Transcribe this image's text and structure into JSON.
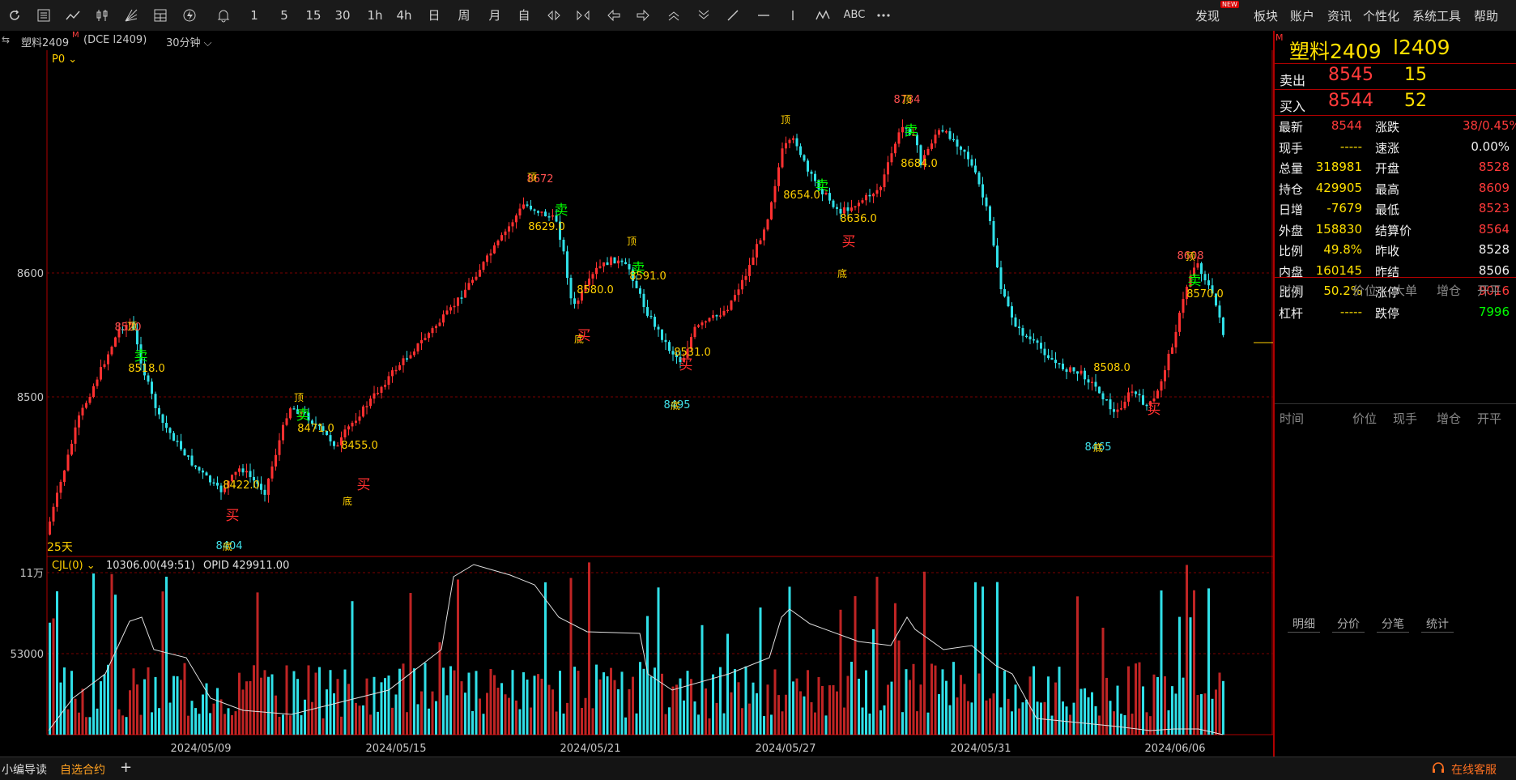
{
  "toolbar": {
    "icons": [
      "refresh-icon",
      "list-icon",
      "line-chart-icon",
      "candle-icon",
      "fan-icon",
      "grid-icon",
      "flash-icon",
      "bell-icon"
    ],
    "periods": [
      "1",
      "5",
      "15",
      "30",
      "1h",
      "4h",
      "日",
      "周",
      "月",
      "自"
    ],
    "right_menu": [
      "发现",
      "板块",
      "账户",
      "资讯",
      "个性化",
      "系统工具",
      "帮助"
    ],
    "new_badge": "NEW",
    "abc": "ABC"
  },
  "header": {
    "symbol": "塑料2409",
    "marker": "M",
    "exchange": "(DCE l2409)",
    "period": "30分钟"
  },
  "main_panel": {
    "indicator": "P0",
    "y_ticks": [
      "8600",
      "8500"
    ],
    "days_label": "25天"
  },
  "volume_panel": {
    "indicator": "CJL(0)",
    "value": "10306.00(49:51)",
    "opid": "OPID 429911.00",
    "y_ticks": [
      "11万",
      "53000"
    ]
  },
  "x_dates": [
    "2024/05/09",
    "2024/05/15",
    "2024/05/21",
    "2024/05/27",
    "2024/05/31",
    "2024/06/06"
  ],
  "annotations": [
    {
      "text": "8520",
      "kind": "hi"
    },
    {
      "text": "顶",
      "kind": "top"
    },
    {
      "text": "卖",
      "kind": "sell"
    },
    {
      "text": "8518.0",
      "kind": "price"
    },
    {
      "text": "顶",
      "kind": "top"
    },
    {
      "text": "卖",
      "kind": "sell"
    },
    {
      "text": "8471.0",
      "kind": "price"
    },
    {
      "text": "8422.0",
      "kind": "price"
    },
    {
      "text": "买",
      "kind": "buy"
    },
    {
      "text": "8404",
      "kind": "lo"
    },
    {
      "text": "底",
      "kind": "bottom"
    },
    {
      "text": "8455.0",
      "kind": "price"
    },
    {
      "text": "底",
      "kind": "bottom"
    },
    {
      "text": "买",
      "kind": "buy"
    },
    {
      "text": "8672",
      "kind": "hi"
    },
    {
      "text": "顶",
      "kind": "top"
    },
    {
      "text": "卖",
      "kind": "sell"
    },
    {
      "text": "8629.0",
      "kind": "price"
    },
    {
      "text": "8580.0",
      "kind": "price"
    },
    {
      "text": "底",
      "kind": "bottom"
    },
    {
      "text": "买",
      "kind": "buy"
    },
    {
      "text": "顶",
      "kind": "top"
    },
    {
      "text": "卖",
      "kind": "sell"
    },
    {
      "text": "8591.0",
      "kind": "price"
    },
    {
      "text": "8531.0",
      "kind": "price"
    },
    {
      "text": "买",
      "kind": "buy"
    },
    {
      "text": "8495",
      "kind": "lo"
    },
    {
      "text": "底",
      "kind": "bottom"
    },
    {
      "text": "顶",
      "kind": "top"
    },
    {
      "text": "卖",
      "kind": "sell"
    },
    {
      "text": "8654.0",
      "kind": "price"
    },
    {
      "text": "8636.0",
      "kind": "price"
    },
    {
      "text": "买",
      "kind": "buy"
    },
    {
      "text": "底",
      "kind": "bottom"
    },
    {
      "text": "8734",
      "kind": "hi"
    },
    {
      "text": "顶",
      "kind": "top"
    },
    {
      "text": "卖",
      "kind": "sell"
    },
    {
      "text": "8684.0",
      "kind": "price"
    },
    {
      "text": "8508.0",
      "kind": "price"
    },
    {
      "text": "8465",
      "kind": "lo"
    },
    {
      "text": "底",
      "kind": "bottom"
    },
    {
      "text": "买",
      "kind": "buy"
    },
    {
      "text": "8608",
      "kind": "hi"
    },
    {
      "text": "顶",
      "kind": "top"
    },
    {
      "text": "卖",
      "kind": "sell"
    },
    {
      "text": "8570.0",
      "kind": "price"
    }
  ],
  "quote": {
    "title_cn": "塑料2409",
    "title_code": "l2409",
    "marker": "M",
    "ask_label": "卖出",
    "ask_price": "8545",
    "ask_vol": "15",
    "bid_label": "买入",
    "bid_price": "8544",
    "bid_vol": "52",
    "rows": [
      {
        "l": "最新",
        "v": "8544",
        "r": "涨跌",
        "rv": "38/0.45%",
        "vc": "red",
        "rvc": "red"
      },
      {
        "l": "现手",
        "v": "-----",
        "r": "速涨",
        "rv": "0.00%",
        "vc": "yel",
        "rvc": "wht"
      },
      {
        "l": "总量",
        "v": "318981",
        "r": "开盘",
        "rv": "8528",
        "vc": "yel",
        "rvc": "red"
      },
      {
        "l": "持仓",
        "v": "429905",
        "r": "最高",
        "rv": "8609",
        "vc": "yel",
        "rvc": "red"
      },
      {
        "l": "日增",
        "v": "-7679",
        "r": "最低",
        "rv": "8523",
        "vc": "yel",
        "rvc": "red"
      },
      {
        "l": "外盘",
        "v": "158830",
        "r": "结算价",
        "rv": "8564",
        "vc": "yel",
        "rvc": "red"
      },
      {
        "l": "比例",
        "v": "49.8%",
        "r": "昨收",
        "rv": "8528",
        "vc": "yel",
        "rvc": "wht"
      },
      {
        "l": "内盘",
        "v": "160145",
        "r": "昨结",
        "rv": "8506",
        "vc": "yel",
        "rvc": "wht"
      },
      {
        "l": "比例",
        "v": "50.2%",
        "r": "涨停",
        "rv": "9016",
        "vc": "yel",
        "rvc": "red"
      },
      {
        "l": "杠杆",
        "v": "-----",
        "r": "跌停",
        "rv": "7996",
        "vc": "yel",
        "rvc": "grn"
      }
    ],
    "table1_headers": [
      "时间",
      "价位",
      "大单",
      "增仓",
      "开平"
    ],
    "table2_headers": [
      "时间",
      "价位",
      "现手",
      "增仓",
      "开平"
    ],
    "tabs": [
      "明细",
      "分价",
      "分笔",
      "统计"
    ]
  },
  "footer": {
    "left1": "小编导读",
    "left2": "自选合约",
    "plus": "+",
    "service": "在线客服"
  },
  "colors": {
    "up": "#ff3030",
    "down": "#30e0e8",
    "accent": "#ffd000",
    "panel_border": "#b00000"
  }
}
